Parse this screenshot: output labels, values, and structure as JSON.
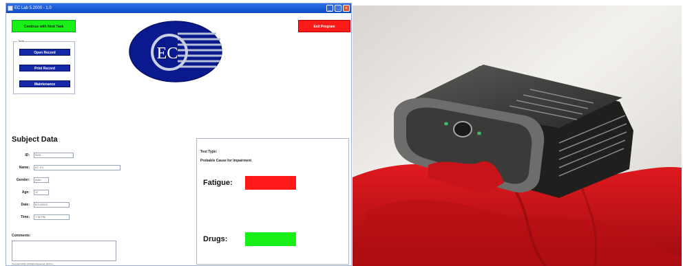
{
  "window": {
    "title": "EC Lab 5.2000 - 1.0",
    "controls": [
      "_",
      "□",
      "×"
    ]
  },
  "toolbar": {
    "continue_label": "Continue with Next Task",
    "exit_label": "Exit Program"
  },
  "tools": {
    "legend": "Tools",
    "buttons": [
      {
        "label": "Open Record"
      },
      {
        "label": "Print Record"
      },
      {
        "label": "Maintenance"
      }
    ]
  },
  "logo": {
    "text": "EC",
    "primary_color": "#0a1a8e",
    "stripe_color": "#b7c0d6"
  },
  "subject": {
    "title": "Subject Data",
    "fields": [
      {
        "label": "ID:",
        "value": "0001"
      },
      {
        "label": "Name:",
        "value": "EC EX"
      },
      {
        "label": "Gender:",
        "value": "male"
      },
      {
        "label": "Age:",
        "value": "37"
      },
      {
        "label": "Date:",
        "value": "6/14/2003"
      },
      {
        "label": "Time:",
        "value": "7:35 PM"
      }
    ],
    "comments_label": "Comments:",
    "comments_value": ""
  },
  "copyright": "Copyright 2003, All Rights Reserved, EC3 Inc.",
  "results": {
    "test_type": "Test Type:",
    "probable_cause": "Probable Cause for Impairment",
    "fatigue_label": "Fatigue:",
    "fatigue_color": "#ff1a1a",
    "drugs_label": "Drugs:",
    "drugs_color": "#18f018"
  },
  "photo": {
    "description_colors": {
      "fabric": "#d10d14",
      "device": "#3a3a38",
      "wall": "#ece9e4"
    }
  }
}
